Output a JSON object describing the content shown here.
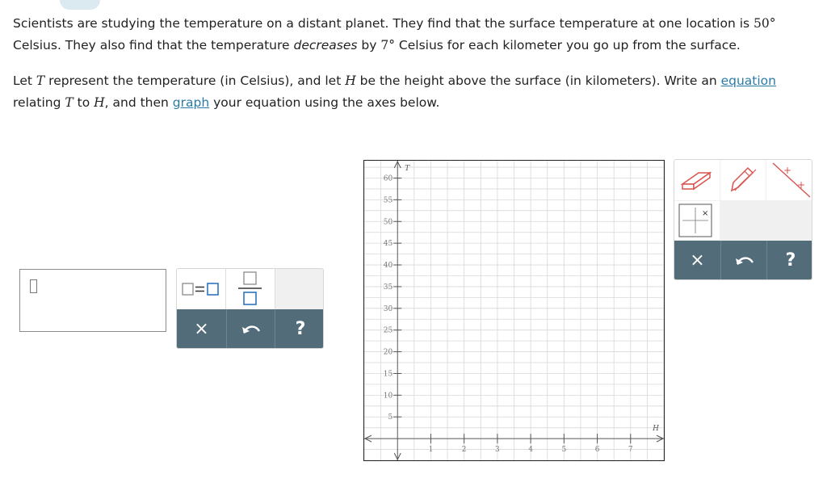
{
  "problem": {
    "p1_a": "Scientists are studying the temperature on a distant planet. They find that the surface temperature at one location is ",
    "p1_temp": "50°",
    "p1_b": "Celsius. They also find that the temperature ",
    "p1_decreases": "decreases",
    "p1_c": " by ",
    "p1_rate": "7°",
    "p1_d": " Celsius for each kilometer you go up from the surface.",
    "p2_let": "Let ",
    "p2_T": "T",
    "p2_a": " represent the temperature (in Celsius), and let ",
    "p2_H": "H",
    "p2_b": " be the height above the surface (in kilometers). Write an ",
    "p2_equation_link": "equation",
    "p2_relating": "relating ",
    "p2_T2": "T",
    "p2_to": " to ",
    "p2_H2": "H",
    "p2_c": ", and then ",
    "p2_graph_link": "graph",
    "p2_d": " your equation using the axes below."
  },
  "equation_toolbar": {
    "clear_symbol": "×",
    "undo_symbol": "↶",
    "help_symbol": "?"
  },
  "graph": {
    "x_axis_label": "H",
    "y_axis_label": "T",
    "x_ticks": [
      "1",
      "2",
      "3",
      "4",
      "5",
      "6",
      "7"
    ],
    "y_ticks": [
      "5",
      "10",
      "15",
      "20",
      "25",
      "30",
      "35",
      "40",
      "45",
      "50",
      "55",
      "60"
    ],
    "x_range": [
      -1,
      8
    ],
    "y_range": [
      -5,
      64
    ]
  },
  "graph_toolbar": {
    "clear_symbol": "×",
    "undo_symbol": "↶",
    "help_symbol": "?"
  }
}
